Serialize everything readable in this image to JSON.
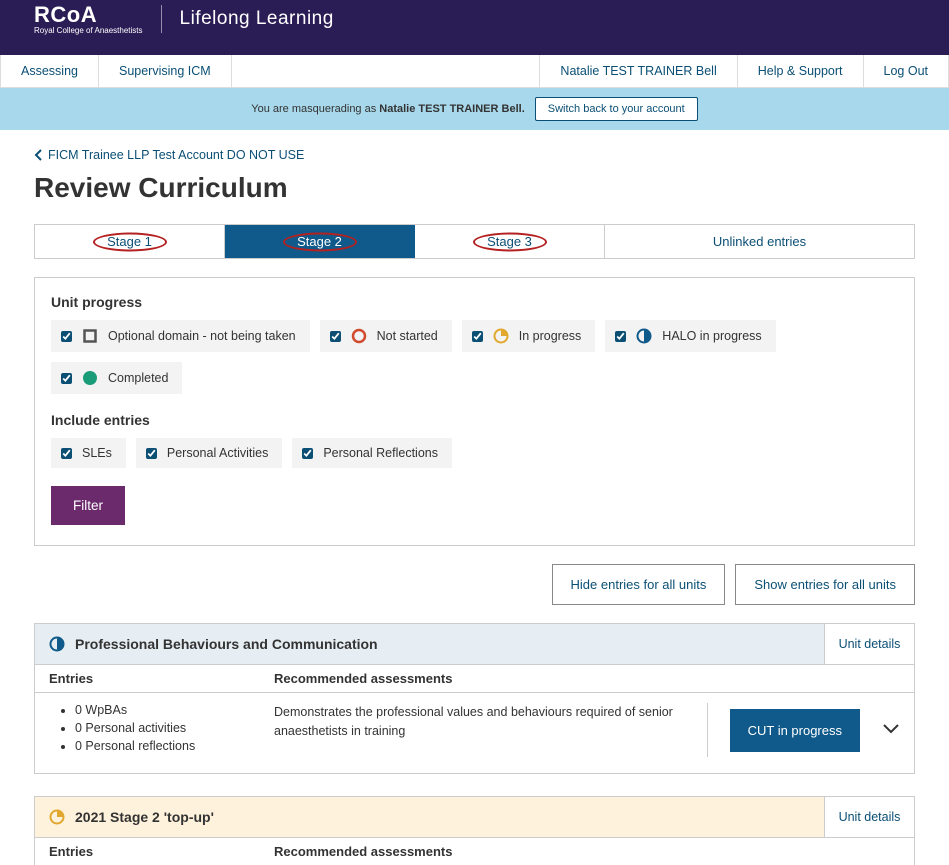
{
  "header": {
    "org_abbrev": "RCoA",
    "org_full": "Royal College of Anaesthetists",
    "app_title": "Lifelong Learning"
  },
  "nav": {
    "left": [
      "Assessing",
      "Supervising ICM"
    ],
    "right": [
      "Natalie TEST TRAINER Bell",
      "Help & Support",
      "Log Out"
    ]
  },
  "masq": {
    "prefix": "You are masquerading as ",
    "user": "Natalie TEST TRAINER Bell.",
    "switch_label": "Switch back to your account"
  },
  "breadcrumb": "FICM Trainee LLP Test Account DO NOT USE",
  "page_title": "Review Curriculum",
  "stage_tabs": {
    "items": [
      "Stage 1",
      "Stage 2",
      "Stage 3",
      "Unlinked entries"
    ],
    "active_index": 1
  },
  "filters": {
    "unit_progress_label": "Unit progress",
    "statuses": [
      {
        "label": "Optional domain - not being taken",
        "kind": "optional"
      },
      {
        "label": "Not started",
        "kind": "notstarted"
      },
      {
        "label": "In progress",
        "kind": "inprogress"
      },
      {
        "label": "HALO in progress",
        "kind": "halo"
      },
      {
        "label": "Completed",
        "kind": "completed"
      }
    ],
    "include_label": "Include entries",
    "include": [
      "SLEs",
      "Personal Activities",
      "Personal Reflections"
    ],
    "filter_btn": "Filter"
  },
  "actions": {
    "hide": "Hide entries for all units",
    "show": "Show entries for all units"
  },
  "cols": {
    "entries": "Entries",
    "recs": "Recommended assessments"
  },
  "units": [
    {
      "title": "Professional Behaviours and Communication",
      "status_kind": "halo",
      "header_variant": "default",
      "details_label": "Unit details",
      "entries": [
        "0 WpBAs",
        "0 Personal activities",
        "0 Personal reflections"
      ],
      "rec_text": "Demonstrates the professional values and behaviours required of senior anaesthetists in training",
      "action_label": "CUT in progress"
    },
    {
      "title": "2021 Stage 2 'top-up'",
      "status_kind": "inprogress",
      "header_variant": "variant",
      "details_label": "Unit details",
      "entries": [],
      "rec_text": "",
      "action_label": ""
    }
  ]
}
